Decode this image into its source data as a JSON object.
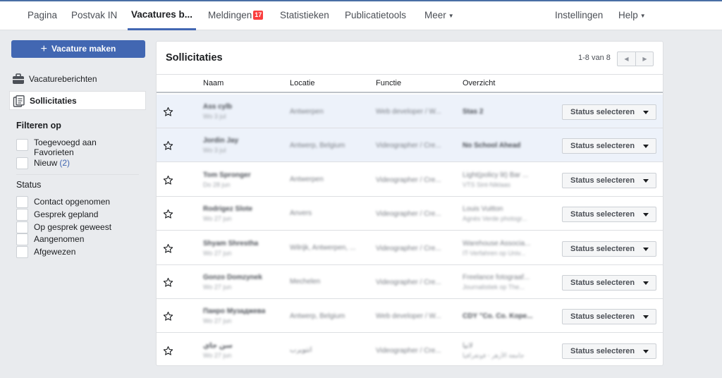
{
  "nav": {
    "items": [
      {
        "label": "Pagina"
      },
      {
        "label": "Postvak IN"
      },
      {
        "label": "Vacatures b..."
      },
      {
        "label": "Meldingen",
        "badge": "17"
      },
      {
        "label": "Statistieken"
      },
      {
        "label": "Publicatietools"
      },
      {
        "label": "Meer"
      },
      {
        "label": "Instellingen"
      },
      {
        "label": "Help"
      }
    ],
    "active_index": 2
  },
  "sidebar": {
    "create_button": "Vacature maken",
    "links": [
      {
        "label": "Vacatureberichten",
        "icon": "briefcase-icon"
      },
      {
        "label": "Sollicitaties",
        "icon": "applications-icon"
      }
    ],
    "filter_heading": "Filteren op",
    "filters": [
      {
        "label": "Toegevoegd aan Favorieten"
      },
      {
        "label": "Nieuw",
        "count": "(2)"
      }
    ],
    "status_heading": "Status",
    "statuses": [
      {
        "label": "Contact opgenomen"
      },
      {
        "label": "Gesprek gepland"
      },
      {
        "label": "Op gesprek geweest"
      },
      {
        "label": "Aangenomen"
      },
      {
        "label": "Afgewezen"
      }
    ]
  },
  "main": {
    "title": "Sollicitaties",
    "pagination": "1-8 van 8",
    "columns": [
      "Naam",
      "Locatie",
      "Functie",
      "Overzicht"
    ],
    "status_button_label": "Status selecteren",
    "rows": [
      {
        "name": "Ass cylb",
        "date": "Wo 3 jul",
        "location": "Antwerpen",
        "function": "Web developer / W...",
        "overview": "Stas 2",
        "overview2": "",
        "highlighted": true
      },
      {
        "name": "Jordin Jay",
        "date": "Wo 3 jul",
        "location": "Antwerp, Belgium",
        "function": "Videographer / Cre...",
        "overview": "No School Ahead",
        "overview2": "",
        "highlighted": true
      },
      {
        "name": "Tom Spronger",
        "date": "Do 28 jun",
        "location": "Antwerpen",
        "function": "Videographer / Cre...",
        "overview": "Light(policy lit) Bar ...",
        "overview2": "VTS Sint-Niklaas",
        "highlighted": false
      },
      {
        "name": "Rodrigez Slote",
        "date": "Wo 27 jun",
        "location": "Anvers",
        "function": "Videographer / Cre...",
        "overview": "Louis Vuitton",
        "overview2": "Agnès Verde photogr...",
        "highlighted": false
      },
      {
        "name": "Shyam Shrestha",
        "date": "Wo 27 jun",
        "location": "Wilrijk, Antwerpen, ...",
        "function": "Videographer / Cre...",
        "overview": "Warehouse Associa...",
        "overview2": "IT-Verfahren op Univ...",
        "highlighted": false
      },
      {
        "name": "Gonzo Domzynek",
        "date": "Wo 27 jun",
        "location": "Mechelen",
        "function": "Videographer / Cre...",
        "overview": "Freelance fotograaf...",
        "overview2": "Journalistiek op The...",
        "highlighted": false
      },
      {
        "name": "Панро Музаджева",
        "date": "Wo 27 jun",
        "location": "Antwerp, Belgium",
        "function": "Web developer / W...",
        "overview": "CDY \"Co. Co. Kope...",
        "overview2": "",
        "highlighted": false
      },
      {
        "name": "سن جاي",
        "date": "Wo 27 jun",
        "location": "أنتويرب",
        "function": "Videographer / Cre...",
        "overview": "لانيا",
        "overview2": "جامعة الأزهر - فوتغرافيا",
        "highlighted": false
      }
    ]
  }
}
